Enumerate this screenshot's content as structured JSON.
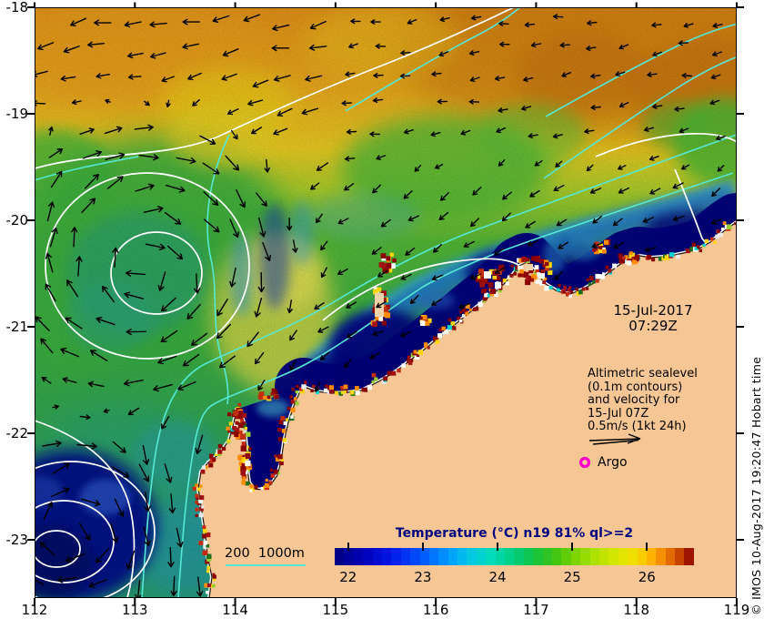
{
  "figure": {
    "date_label": "15-Jul-2017",
    "time_label": "07:29Z",
    "annotation_lines": [
      "Altimetric sealevel",
      "(0.1m contours)",
      "and velocity for",
      "15-Jul 07Z",
      "0.5m/s (1kt 24h)"
    ],
    "argo_label": "Argo",
    "bathy_legend_label": "200  1000m",
    "credit": "© IMOS 10-Aug-2017 19:20:47 Hobart time"
  },
  "axes": {
    "lon_ticks": [
      "112",
      "113",
      "114",
      "115",
      "116",
      "117",
      "118",
      "119"
    ],
    "lat_ticks": [
      "-18",
      "-19",
      "-20",
      "-21",
      "-22",
      "-23"
    ]
  },
  "colorbar": {
    "title": "Temperature (°C) n19 81% ql>=2",
    "tick_labels": [
      "22",
      "23",
      "24",
      "25",
      "26"
    ],
    "tick_values": [
      22,
      23,
      24,
      25,
      26
    ],
    "range": [
      21.82,
      26.63
    ],
    "gradient": [
      [
        0.0,
        "#000080"
      ],
      [
        0.08,
        "#0000B8"
      ],
      [
        0.16,
        "#0018E8"
      ],
      [
        0.24,
        "#0055FF"
      ],
      [
        0.31,
        "#0095FF"
      ],
      [
        0.37,
        "#00C4E8"
      ],
      [
        0.43,
        "#00DCC0"
      ],
      [
        0.49,
        "#00D088"
      ],
      [
        0.55,
        "#10C445"
      ],
      [
        0.61,
        "#3CC414"
      ],
      [
        0.67,
        "#7CD400"
      ],
      [
        0.73,
        "#B2E200"
      ],
      [
        0.79,
        "#DCE800"
      ],
      [
        0.84,
        "#F4DC00"
      ],
      [
        0.88,
        "#FFB400"
      ],
      [
        0.92,
        "#F08000"
      ],
      [
        0.96,
        "#C84400"
      ],
      [
        1.0,
        "#8B0000"
      ]
    ]
  },
  "map_info": {
    "lon_range": [
      112,
      119
    ],
    "lat_range": [
      -23.55,
      -18
    ]
  },
  "colors": {
    "land": "#F6C795",
    "coastal_cold_water": "#000080",
    "contour_sealevel": "#FFFFFF",
    "contour_bathymetry": "#55E8D4",
    "argo_marker": "#FF00CC",
    "arrow": "#000000",
    "colorbar_title": "#000080"
  }
}
